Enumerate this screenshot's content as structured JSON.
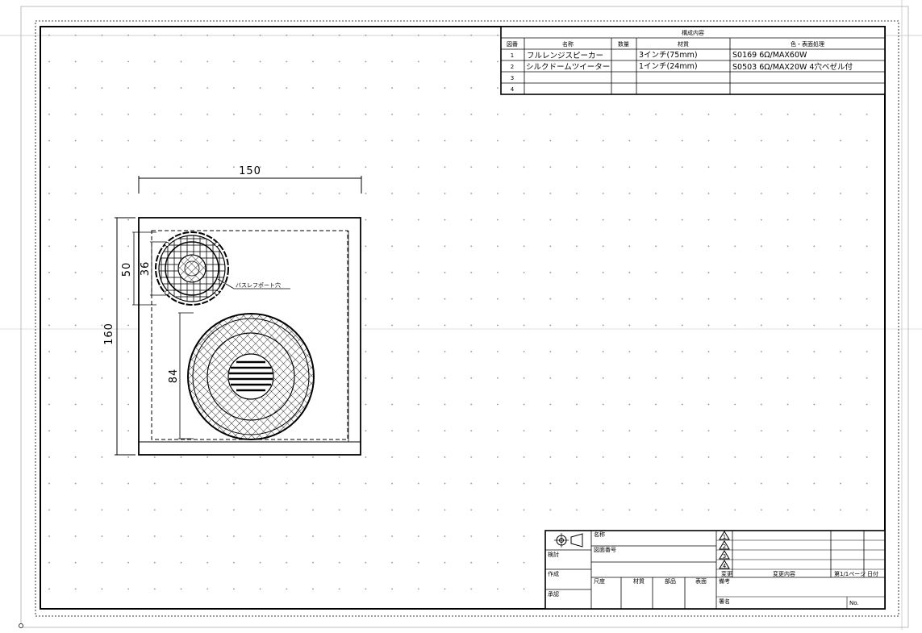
{
  "parts_table": {
    "title": "構成内容",
    "headers": [
      "図番",
      "名称",
      "数量",
      "材質",
      "色・表面処理"
    ],
    "rows": [
      {
        "no": "1",
        "name": "フルレンジスピーカー",
        "qty": "",
        "material": "3インチ(75mm)",
        "finish": "S0169 6Ω/MAX60W"
      },
      {
        "no": "2",
        "name": "シルクドームツイーター",
        "qty": "",
        "material": "1インチ(24mm)",
        "finish": "S0503 6Ω/MAX20W 4穴ベゼル付"
      },
      {
        "no": "3",
        "name": "",
        "qty": "",
        "material": "",
        "finish": ""
      },
      {
        "no": "4",
        "name": "",
        "qty": "",
        "material": "",
        "finish": ""
      }
    ]
  },
  "drawing": {
    "dim_width": "150",
    "dim_height": "160",
    "dim_port_outer": "50",
    "dim_port_inner": "36",
    "dim_speaker": "84",
    "port_label": "バスレフポート穴"
  },
  "title_block": {
    "l_kata": "承認",
    "l_kentou": "検討",
    "l_sakusei": "作成",
    "l_meishou": "名称",
    "l_zuban": "図面番号",
    "l_shakudo": "尺度",
    "l_zaishitsu": "材質",
    "l_buhin": "部品",
    "l_hyomen": "表面",
    "l_tantou": "担当",
    "l_kaitei": "変更",
    "l_kaitei_naiyo": "変更内容",
    "l_page": "第1/1ページ",
    "l_date": "日付",
    "l_bikou": "備考",
    "l_shomei": "署名",
    "l_name_no": "No.",
    "rev_marks": [
      "1",
      "2",
      "3",
      "4"
    ]
  }
}
